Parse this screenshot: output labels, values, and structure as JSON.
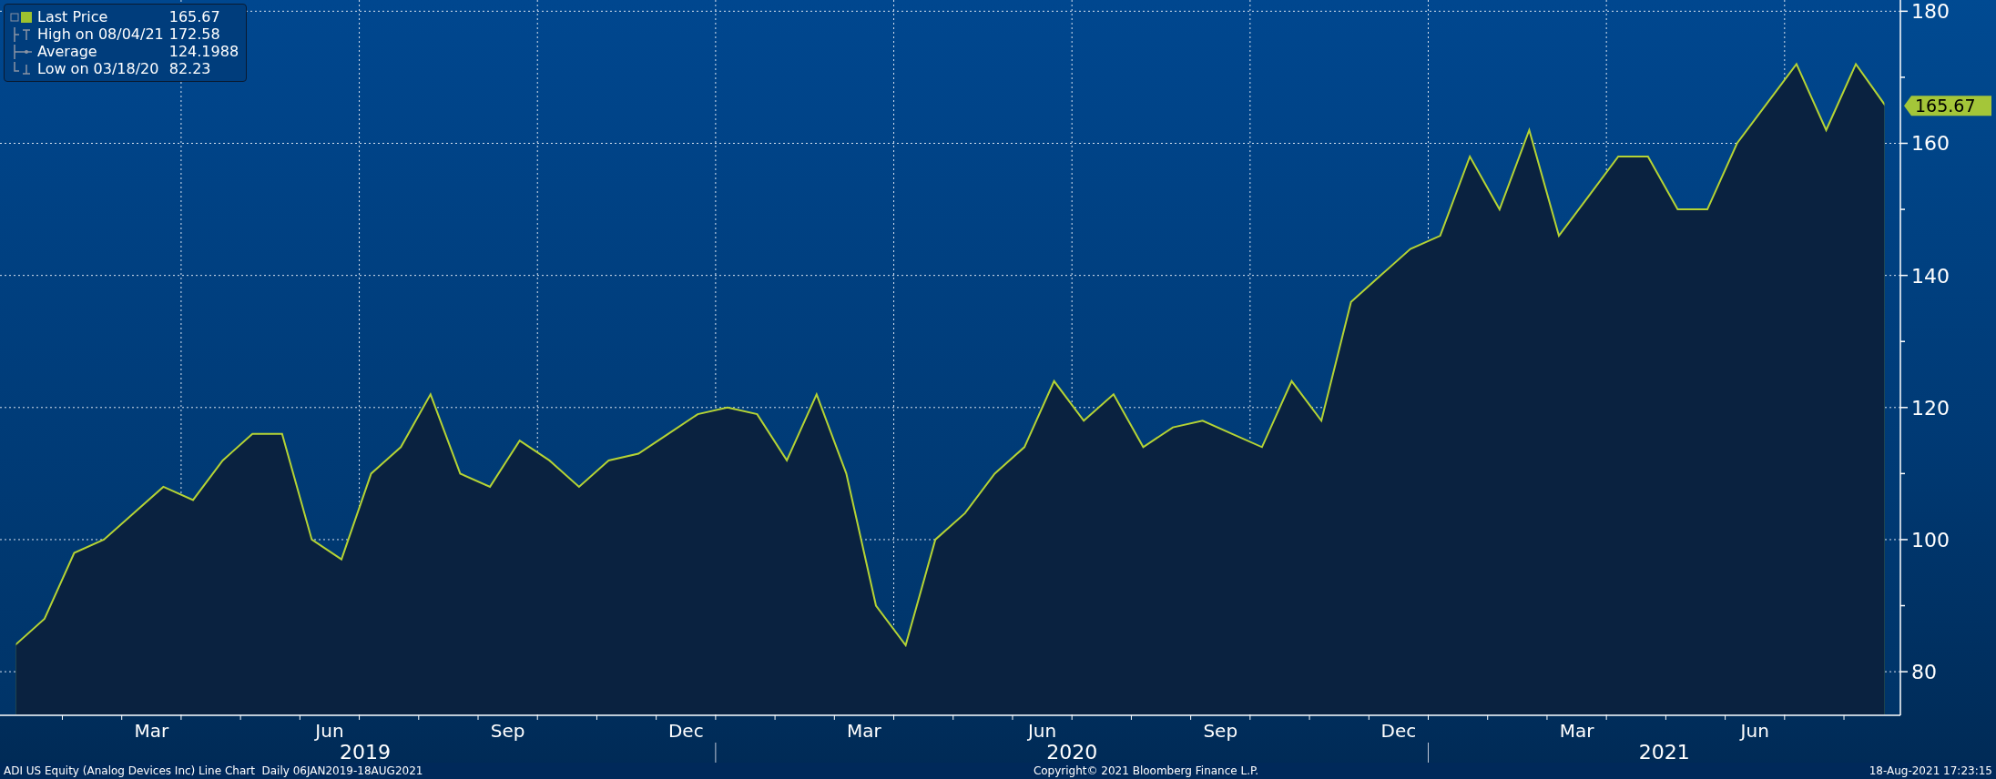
{
  "legend": [
    {
      "kind": "last",
      "label": "Last Price",
      "value": "165.67",
      "color": "#9dc12f"
    },
    {
      "kind": "high",
      "label": "High on 08/04/21",
      "value": "172.58"
    },
    {
      "kind": "average",
      "label": "Average",
      "value": "124.1988"
    },
    {
      "kind": "low",
      "label": "Low on 03/18/20",
      "value": "82.23"
    }
  ],
  "price_tag": "165.67",
  "chart_data": {
    "type": "area",
    "categories": [
      null,
      null,
      null,
      null,
      null,
      "Mar",
      null,
      null,
      null,
      null,
      null,
      "Jun",
      null,
      null,
      null,
      null,
      null,
      "Sep",
      null,
      null,
      null,
      null,
      null,
      "Dec",
      null,
      null,
      null,
      null,
      null,
      "Mar",
      null,
      null,
      null,
      null,
      null,
      "Jun",
      null,
      null,
      null,
      null,
      null,
      "Sep",
      null,
      null,
      null,
      null,
      null,
      "Dec",
      null,
      null,
      null,
      null,
      null,
      "Mar",
      null,
      null,
      null,
      null,
      null,
      "Jun",
      null,
      null,
      null,
      null
    ],
    "series": [
      {
        "color": "#b5d334",
        "values": [
          84,
          88,
          98,
          100,
          104,
          108,
          106,
          112,
          116,
          116,
          100,
          97,
          110,
          114,
          122,
          110,
          108,
          115,
          112,
          108,
          112,
          113,
          116,
          119,
          120,
          119,
          112,
          122,
          110,
          90,
          84,
          100,
          104,
          110,
          114,
          124,
          118,
          122,
          114,
          117,
          118,
          116,
          114,
          124,
          118,
          136,
          140,
          144,
          146,
          158,
          150,
          162,
          146,
          152,
          158,
          158,
          150,
          150,
          160,
          166,
          172,
          162,
          172,
          165.67
        ]
      }
    ],
    "ylim": [
      73.4,
      181.7
    ],
    "grid": true,
    "yticks": [
      80,
      100,
      120,
      140,
      160,
      180
    ]
  },
  "x_axis_years": [
    "2019",
    "2020",
    "2021"
  ],
  "footer": {
    "description": "ADI US Equity (Analog Devices Inc) Line Chart  Daily 06JAN2019-18AUG2021",
    "copyright": "Copyright© 2021 Bloomberg Finance L.P.",
    "timestamp": "18-Aug-2021 17:23:15"
  }
}
